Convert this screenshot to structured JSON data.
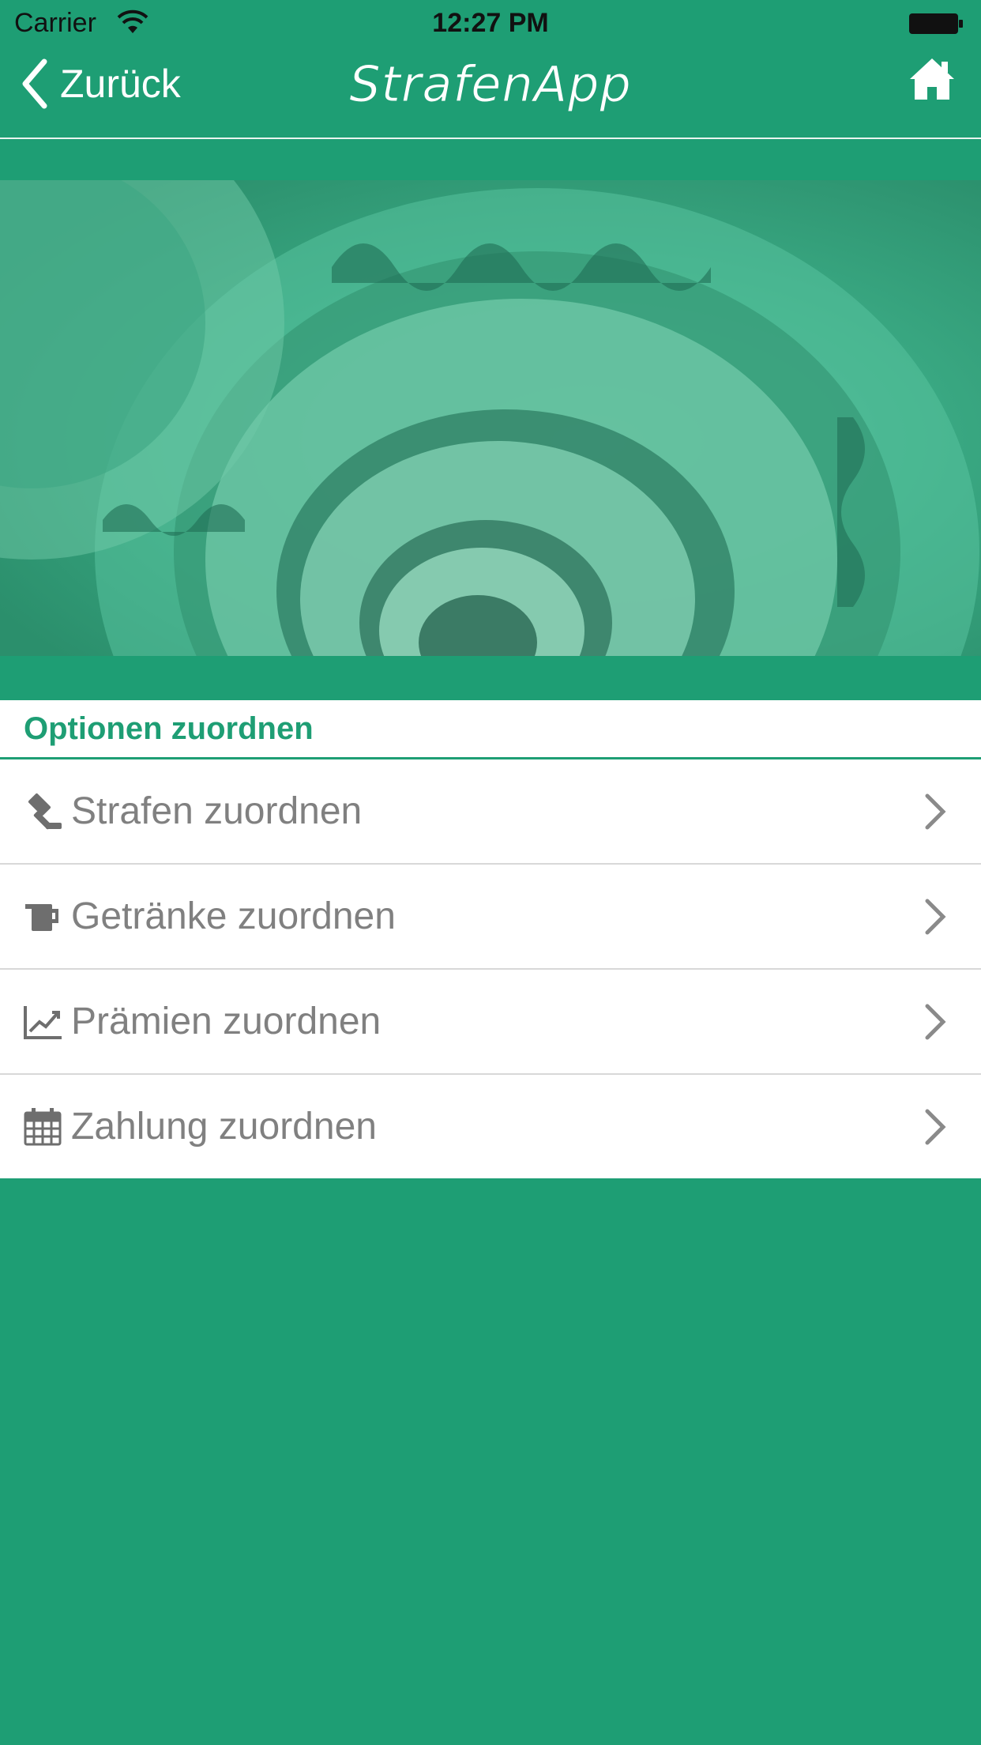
{
  "status_bar": {
    "carrier": "Carrier",
    "time": "12:27 PM"
  },
  "nav": {
    "back_label": "Zurück",
    "logo_text": "StrafenApp"
  },
  "section": {
    "title": "Optionen zuordnen"
  },
  "items": [
    {
      "label": "Strafen zuordnen",
      "icon": "gavel-icon"
    },
    {
      "label": "Getränke zuordnen",
      "icon": "beer-mug-icon"
    },
    {
      "label": "Prämien zuordnen",
      "icon": "line-chart-icon"
    },
    {
      "label": "Zahlung zuordnen",
      "icon": "calendar-icon"
    }
  ],
  "colors": {
    "primary": "#1e9e74",
    "text_gray": "#808080",
    "divider": "#d8d8d8"
  }
}
